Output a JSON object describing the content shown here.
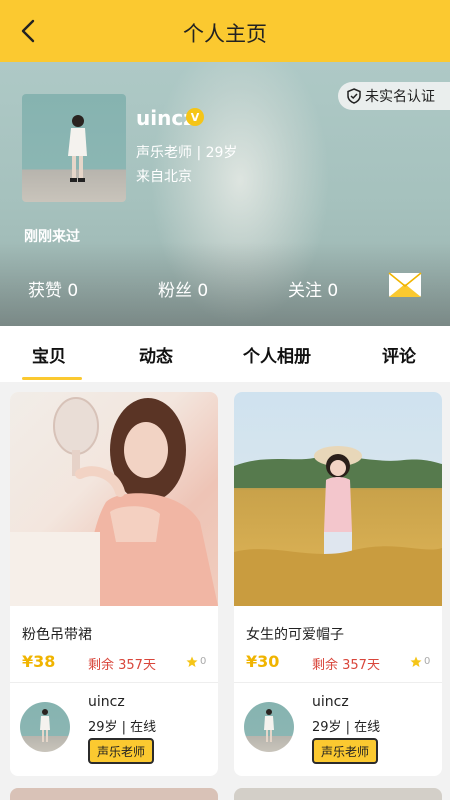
{
  "header": {
    "title": "个人主页"
  },
  "profile": {
    "verify_badge": "未实名认证",
    "name": "uincz",
    "vip_mark": "V",
    "meta": "声乐老师 | 29岁",
    "city": "来自北京",
    "last_seen": "刚刚来过",
    "stats": {
      "likes": "获赞 0",
      "fans": "粉丝 0",
      "follow": "关注 0"
    }
  },
  "tabs": {
    "baby": "宝贝",
    "dynamics": "动态",
    "album": "个人相册",
    "comments": "评论"
  },
  "cards": [
    {
      "title": "粉色吊带裙",
      "price": "¥38",
      "remain": "剩余 357天",
      "stars": "0",
      "seller": "uincz",
      "seller_meta": "29岁 | 在线",
      "tag": "声乐老师"
    },
    {
      "title": "女生的可爱帽子",
      "price": "¥30",
      "remain": "剩余 357天",
      "stars": "0",
      "seller": "uincz",
      "seller_meta": "29岁 | 在线",
      "tag": "声乐老师"
    }
  ],
  "colors": {
    "accent": "#fbc930",
    "price": "#f0b400",
    "remain": "#d9463b"
  }
}
